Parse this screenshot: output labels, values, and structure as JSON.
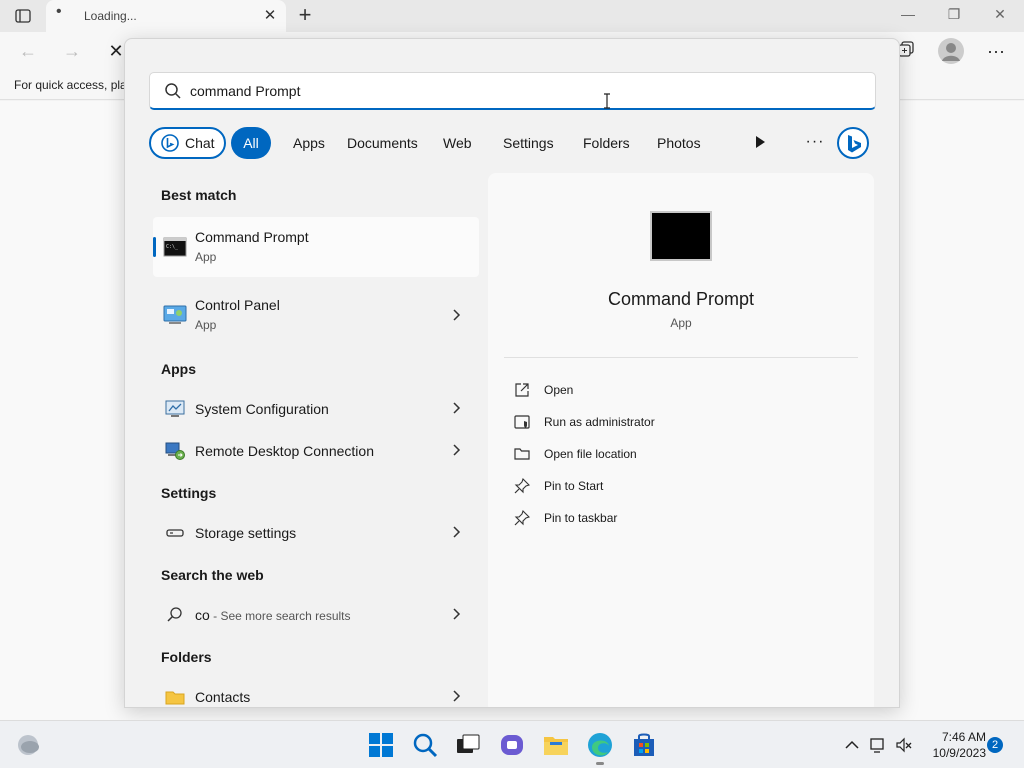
{
  "browser": {
    "tab_title": "Loading...",
    "tab_favicon": "•",
    "favbar_text": "For quick access, pla"
  },
  "search": {
    "query": "command Prompt",
    "filters": [
      "Chat",
      "All",
      "Apps",
      "Documents",
      "Web",
      "Settings",
      "Folders",
      "Photos"
    ],
    "more": "···"
  },
  "results": {
    "best_match_heading": "Best match",
    "best_match": [
      {
        "name": "Command Prompt",
        "type": "App"
      },
      {
        "name": "Control Panel",
        "type": "App"
      }
    ],
    "apps_heading": "Apps",
    "apps": [
      {
        "name": "System Configuration"
      },
      {
        "name": "Remote Desktop Connection"
      }
    ],
    "settings_heading": "Settings",
    "settings": [
      {
        "name": "Storage settings"
      }
    ],
    "web_heading": "Search the web",
    "web": [
      {
        "name": "co",
        "sub": " - See more search results"
      }
    ],
    "folders_heading": "Folders",
    "folders": [
      {
        "name": "Contacts"
      }
    ]
  },
  "preview": {
    "name": "Command Prompt",
    "type": "App",
    "actions": [
      "Open",
      "Run as administrator",
      "Open file location",
      "Pin to Start",
      "Pin to taskbar"
    ]
  },
  "taskbar": {
    "time": "7:46 AM",
    "date": "10/9/2023",
    "notification_count": "2"
  },
  "colors": {
    "accent": "#0067c0",
    "panel": "#f2f2f2"
  }
}
